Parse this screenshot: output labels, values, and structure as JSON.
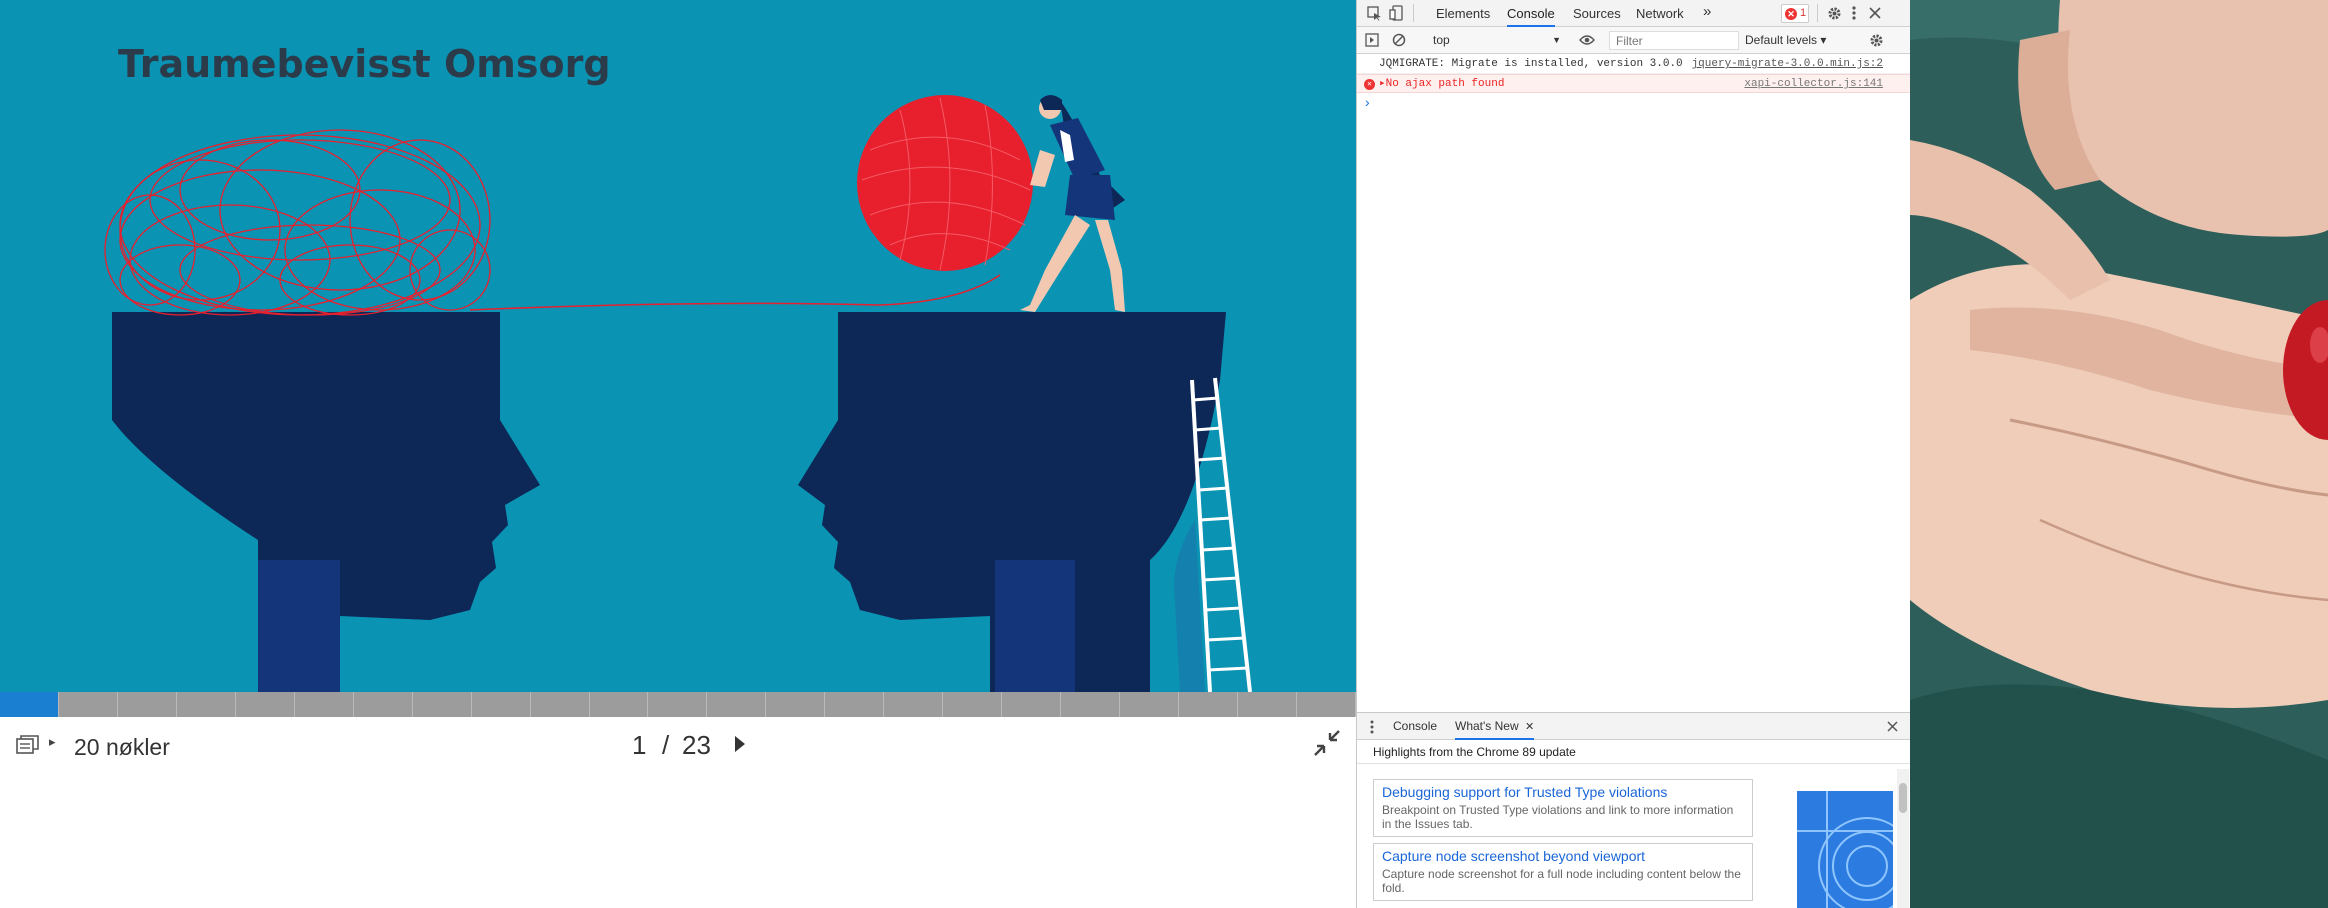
{
  "slide": {
    "title": "Traumebevisst Omsorg"
  },
  "progress": {
    "total_segments": 23,
    "current": 1
  },
  "footer": {
    "keywords_label": "20 nøkler",
    "current_slide": "1",
    "separator": "/",
    "total_slides": "23"
  },
  "devtools": {
    "tabs": [
      "Elements",
      "Console",
      "Sources",
      "Network"
    ],
    "more": "»",
    "error_count": "1",
    "context": "top",
    "filter_placeholder": "Filter",
    "levels": "Default levels ▾",
    "logs": [
      {
        "text": "JQMIGRATE: Migrate is installed, version 3.0.0",
        "source": "jquery-migrate-3.0.0.min.js:2",
        "level": "info"
      },
      {
        "text": "▸No ajax path found",
        "source": "xapi-collector.js:141",
        "level": "error"
      }
    ],
    "prompt": "›",
    "drawer": {
      "tabs": [
        "Console",
        "What's New"
      ],
      "header": "Highlights from the Chrome 89 update",
      "cards": [
        {
          "title": "Debugging support for Trusted Type violations",
          "desc": "Breakpoint on Trusted Type violations and link to more information in the Issues tab."
        },
        {
          "title": "Capture node screenshot beyond viewport",
          "desc": "Capture node screenshot for a full node including content below the fold."
        }
      ]
    }
  },
  "colors": {
    "slide_bg": "#0a93b3",
    "head_navy": "#0d2757",
    "yarn_red": "#e8202e",
    "progress_active": "#1a7ed1",
    "link_blue": "#1a66d8"
  }
}
